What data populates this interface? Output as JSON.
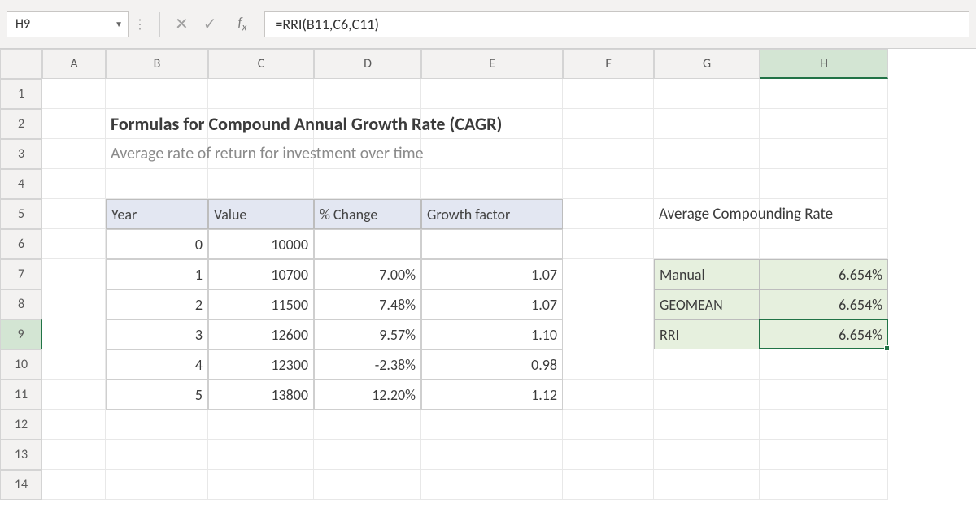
{
  "namebox": "H9",
  "formula": "=RRI(B11,C6,C11)",
  "columns": [
    "A",
    "B",
    "C",
    "D",
    "E",
    "F",
    "G",
    "H"
  ],
  "rows": [
    "1",
    "2",
    "3",
    "4",
    "5",
    "6",
    "7",
    "8",
    "9",
    "10",
    "11",
    "12",
    "13",
    "14"
  ],
  "title": "Formulas for Compound Annual Growth Rate (CAGR)",
  "subtitle": "Average rate of return for investment over time",
  "table": {
    "headers": [
      "Year",
      "Value",
      "% Change",
      "Growth factor"
    ],
    "rows": [
      {
        "year": "0",
        "value": "10000",
        "pct": "",
        "gf": ""
      },
      {
        "year": "1",
        "value": "10700",
        "pct": "7.00%",
        "gf": "1.07"
      },
      {
        "year": "2",
        "value": "11500",
        "pct": "7.48%",
        "gf": "1.07"
      },
      {
        "year": "3",
        "value": "12600",
        "pct": "9.57%",
        "gf": "1.10"
      },
      {
        "year": "4",
        "value": "12300",
        "pct": "-2.38%",
        "gf": "0.98"
      },
      {
        "year": "5",
        "value": "13800",
        "pct": "12.20%",
        "gf": "1.12"
      }
    ]
  },
  "side": {
    "title": "Average Compounding Rate",
    "rows": [
      {
        "label": "Manual",
        "value": "6.654%"
      },
      {
        "label": "GEOMEAN",
        "value": "6.654%"
      },
      {
        "label": "RRI",
        "value": "6.654%"
      }
    ]
  },
  "selected": {
    "col": "H",
    "row": "9"
  }
}
